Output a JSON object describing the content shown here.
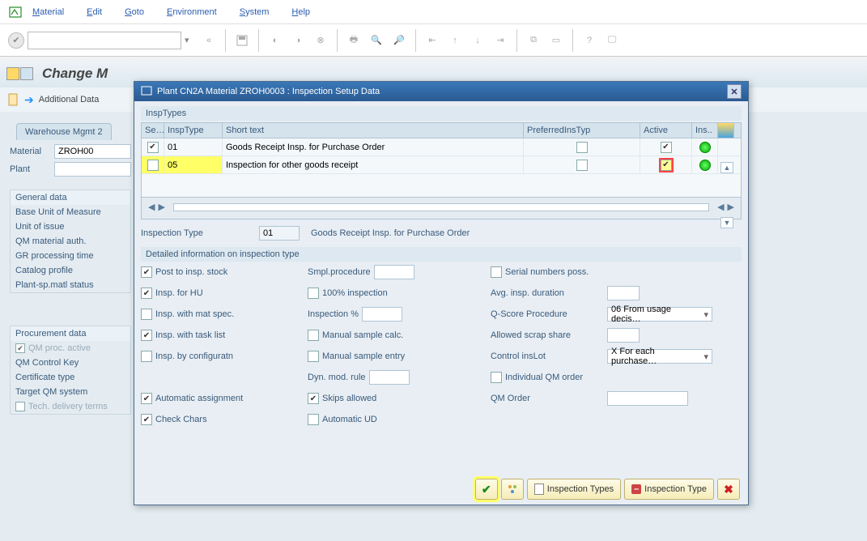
{
  "menu": {
    "m1": "Material",
    "m2": "Edit",
    "m3": "Goto",
    "m4": "Environment",
    "m5": "System",
    "m6": "Help"
  },
  "page": {
    "title": "Change M",
    "additional": "Additional Data"
  },
  "tabs": {
    "wh": "Warehouse Mgmt 2"
  },
  "left": {
    "material_lbl": "Material",
    "material_val": "ZROH00",
    "plant_lbl": "Plant",
    "grp1": "General data",
    "g1a": "Base Unit of Measure",
    "g1b": "Unit of issue",
    "g1c": "QM material auth.",
    "g1d": "GR processing time",
    "g1e": "Catalog profile",
    "g1f": "Plant-sp.matl status",
    "grp2": "Procurement data",
    "g2a": "QM proc. active",
    "g2b": "QM Control Key",
    "g2c": "Certificate type",
    "g2d": "Target QM system",
    "g2e": "Tech. delivery terms"
  },
  "modal": {
    "title": "Plant CN2A Material ZROH0003 : Inspection Setup Data",
    "insp_types": "InspTypes",
    "th_se": "Se…",
    "th_type": "InspType",
    "th_short": "Short text",
    "th_pref": "PreferredInsTyp",
    "th_active": "Active",
    "th_ins": "Ins..",
    "rows": [
      {
        "type": "01",
        "short": "Goods Receipt Insp. for Purchase Order",
        "sel": true,
        "active": true
      },
      {
        "type": "05",
        "short": "Inspection for other goods receipt",
        "sel": false,
        "active": true,
        "hl": true
      }
    ],
    "it_label": "Inspection Type",
    "it_val": "01",
    "it_desc": "Goods Receipt Insp. for Purchase Order",
    "detail_title": "Detailed information on inspection type",
    "c1": {
      "a": "Post to insp. stock",
      "b": "Insp. for HU",
      "c": "Insp. with mat spec.",
      "d": "Insp. with task list",
      "e": "Insp. by configuratn",
      "f": "Automatic assignment",
      "g": "Check Chars"
    },
    "c2": {
      "a": "Smpl.procedure",
      "b": "100% inspection",
      "c": "Inspection %",
      "d": "Manual sample calc.",
      "e": "Manual sample entry",
      "f": "Dyn. mod. rule",
      "g": "Skips allowed",
      "h": "Automatic UD"
    },
    "c3": {
      "a": "Serial numbers poss.",
      "b": "Avg. insp. duration",
      "c": "Q-Score Procedure",
      "d": "Allowed scrap share",
      "e": "Control insLot",
      "f": "Individual QM order",
      "g": "QM Order",
      "qscore": "06 From usage decis…",
      "ctrl": "X For each purchase…"
    },
    "footer": {
      "types": "Inspection Types",
      "type": "Inspection Type"
    }
  }
}
